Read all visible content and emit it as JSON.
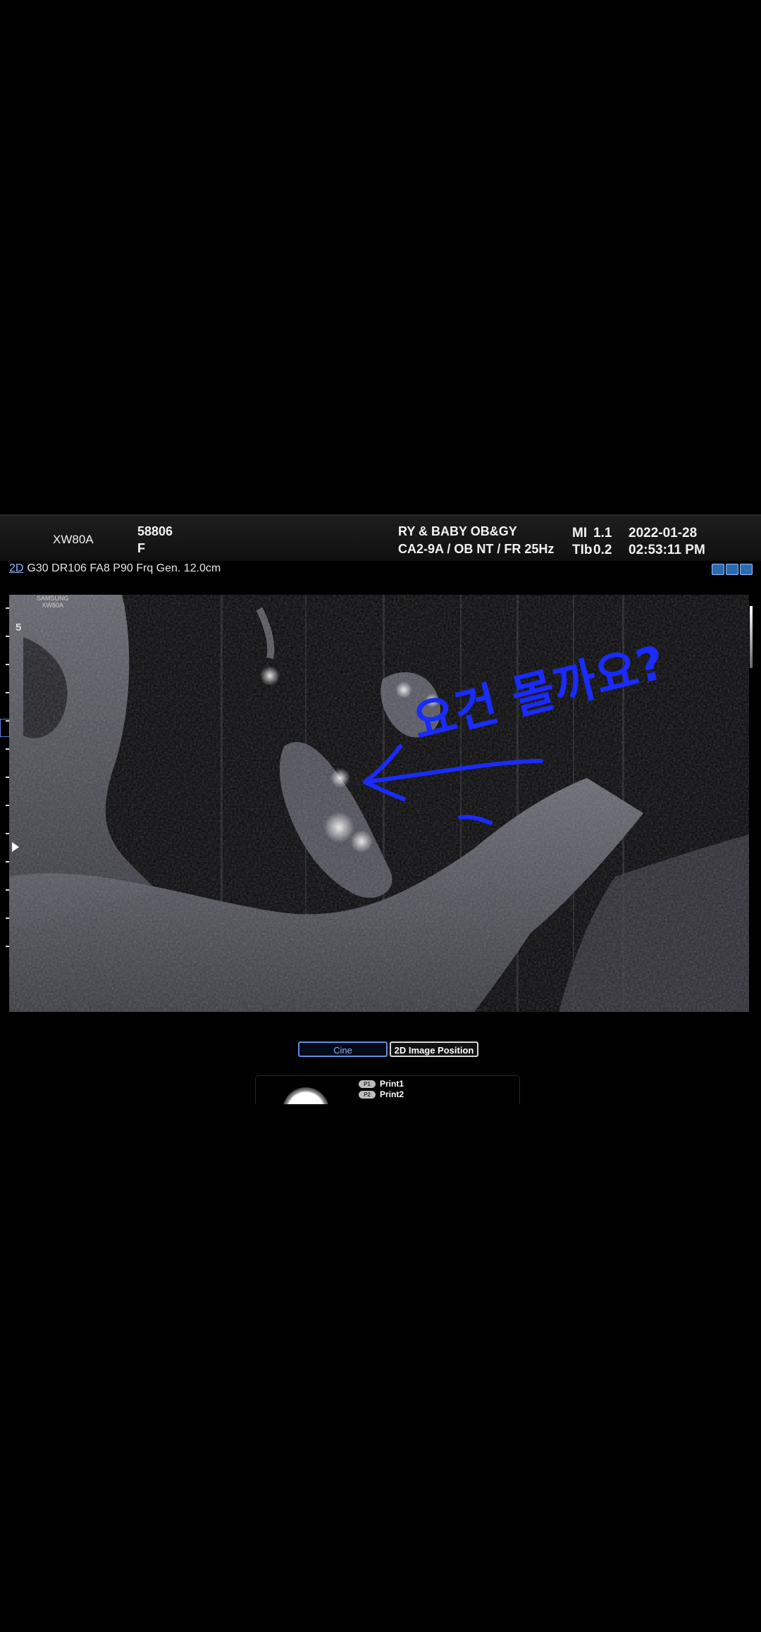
{
  "header": {
    "model": "XW80A",
    "patient_id": "58806",
    "sex": "F",
    "hospital": "RY & BABY OB&GY",
    "probe_preset": "CA2-9A / OB NT / FR 25Hz",
    "mi_label": "MI",
    "mi_value": "1.1",
    "tib_label": "TIb",
    "tib_value": "0.2",
    "date": "2022-01-28",
    "time": "02:53:11 PM"
  },
  "params": {
    "mode": "2D",
    "text": "G30 DR106 FA8 P90 Frq Gen. 12.0cm"
  },
  "image": {
    "brand_line1": "SAMSUNG",
    "brand_line2": "XW80A",
    "depth_marker": "5",
    "annotation_text": "요건 몰까요?",
    "annotation_color": "#1a2bff"
  },
  "buttons": {
    "cine": "Cine",
    "image_position": "2D Image Position"
  },
  "print": {
    "p1_badge": "P1",
    "p1_label": "Print1",
    "p2_badge": "P2",
    "p2_label": "Print2"
  },
  "colors": {
    "background": "#000000",
    "accent_blue": "#5f8fe0"
  }
}
